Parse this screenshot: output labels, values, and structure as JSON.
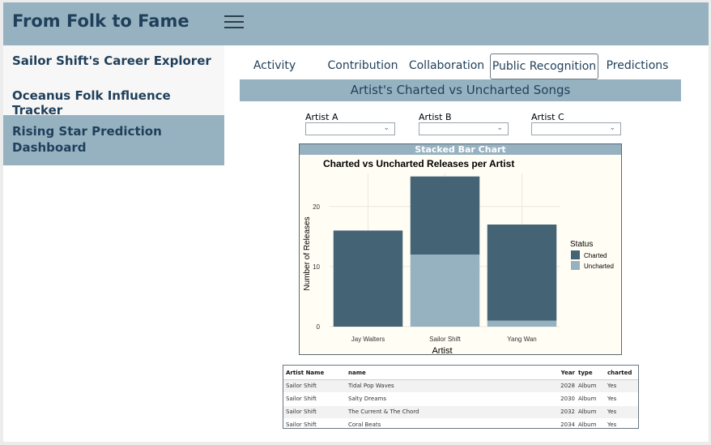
{
  "header": {
    "title": "From Folk to Fame"
  },
  "sidebar": {
    "items": [
      {
        "label": "Sailor Shift's Career Explorer",
        "active": false
      },
      {
        "label": "Oceanus Folk Influence Tracker",
        "active": false
      },
      {
        "label": "Rising Star Prediction Dashboard",
        "active": true
      }
    ]
  },
  "tabs": [
    {
      "label": "Activity",
      "active": false
    },
    {
      "label": "Contribution",
      "active": false
    },
    {
      "label": "Collaboration",
      "active": false
    },
    {
      "label": "Public Recognition",
      "active": true
    },
    {
      "label": "Predictions",
      "active": false
    }
  ],
  "section": {
    "title": "Artist's Charted vs Uncharted Songs"
  },
  "selectors": [
    {
      "label": "Artist A",
      "value": ""
    },
    {
      "label": "Artist B",
      "value": ""
    },
    {
      "label": "Artist C",
      "value": ""
    }
  ],
  "chart_panel": {
    "strip_title": "Stacked Bar Chart"
  },
  "colors": {
    "charted": "#446476",
    "uncharted": "#96b2c1",
    "accent": "#96b2c1",
    "text": "#1f3f5a"
  },
  "chart_data": {
    "type": "bar",
    "stacked": true,
    "title": "Charted vs Uncharted Releases per Artist",
    "xlabel": "Artist",
    "ylabel": "Number of Releases",
    "categories": [
      "Jay Walters",
      "Sailor Shift",
      "Yang Wan"
    ],
    "series": [
      {
        "name": "Uncharted",
        "values": [
          0,
          12,
          1
        ]
      },
      {
        "name": "Charted",
        "values": [
          16,
          13,
          16
        ]
      }
    ],
    "yticks": [
      0,
      10,
      20
    ],
    "ylim": [
      0,
      25.5
    ],
    "legend": {
      "title": "Status",
      "entries": [
        "Charted",
        "Uncharted"
      ],
      "position": "right"
    },
    "grid": true
  },
  "table": {
    "columns": [
      "Artist Name",
      "name",
      "Year",
      "type",
      "charted"
    ],
    "rows": [
      [
        "Sailor Shift",
        "Tidal Pop Waves",
        "2028",
        "Album",
        "Yes"
      ],
      [
        "Sailor Shift",
        "Salty Dreams",
        "2030",
        "Album",
        "Yes"
      ],
      [
        "Sailor Shift",
        "The Current & The Chord",
        "2032",
        "Album",
        "Yes"
      ],
      [
        "Sailor Shift",
        "Coral Beats",
        "2034",
        "Album",
        "Yes"
      ]
    ]
  }
}
